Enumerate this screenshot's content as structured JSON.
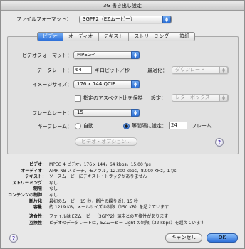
{
  "window": {
    "title": "3G 書き出し設定"
  },
  "file_format": {
    "label": "ファイルフォーマット：",
    "value": "3GPP2（EZムービー）"
  },
  "tabs": [
    "ビデオ",
    "オーディオ",
    "テキスト",
    "ストリーミング",
    "詳細"
  ],
  "active_tab": "ビデオ",
  "video": {
    "format_label": "ビデオフォーマット：",
    "format_value": "MPEG-4",
    "datarate_label": "データレート：",
    "datarate_value": "64",
    "datarate_unit": "キロビット／秒",
    "optimize_label": "最適化：",
    "optimize_value": "ダウンロード",
    "imagesize_label": "イメージサイズ：",
    "imagesize_value": "176 x 144 QCIF",
    "aspect_checkbox_label": "指定のアスペクト比を保持",
    "aspect_setting_label": "設定：",
    "aspect_setting_value": "レターボックス",
    "framerate_label": "フレームレート：",
    "framerate_value": "15",
    "keyframe_label": "キーフレーム：",
    "keyframe_auto": "自動",
    "keyframe_interval": "等間隔に設定：",
    "keyframe_interval_value": "24",
    "keyframe_unit": "フレーム",
    "options_button": "ビデオ・オプション..."
  },
  "summary": [
    {
      "key": "ビデオ：",
      "value": "MPEG 4 ビデオ，176 x 144，64 kbps，15.00 fps"
    },
    {
      "key": "オーディオ：",
      "value": "AMR-NB スピーチ，モノラル，12.200 kbps，8.000 KHz，1 f/s"
    },
    {
      "key": "テキスト：",
      "value": "ソースムービーにテキスト・トラックがありません"
    },
    {
      "key": "ストリーミング：",
      "value": "なし"
    },
    {
      "key": "制限：",
      "value": "なし"
    },
    {
      "key": "コンテンツの制御：",
      "value": "なし"
    },
    {
      "key": "断片化：",
      "value": "最初のムービー 15 秒，断片の繰り返し 15 秒"
    },
    {
      "key": "容量：",
      "value": "約 1219 KB，メールサイズの制限（150 KB）を超えています"
    }
  ],
  "compatibility": [
    {
      "key": "適合性：",
      "value": "ファイルは EZムービー（3GPP2）端末との互換性があります"
    },
    {
      "key": "互換性：",
      "value": "ビデオのデータレートは，EZムービー Light の制限（32 kbps）を超えています"
    }
  ],
  "buttons": {
    "cancel": "キャンセル",
    "ok": "OK"
  },
  "help_glyph": "?",
  "icons": {
    "help": "help-icon",
    "popup_arrow": "popup-arrow-icon"
  },
  "colors": {
    "accent": "#2c6fd8",
    "window_bg": "#e8e8e8"
  }
}
